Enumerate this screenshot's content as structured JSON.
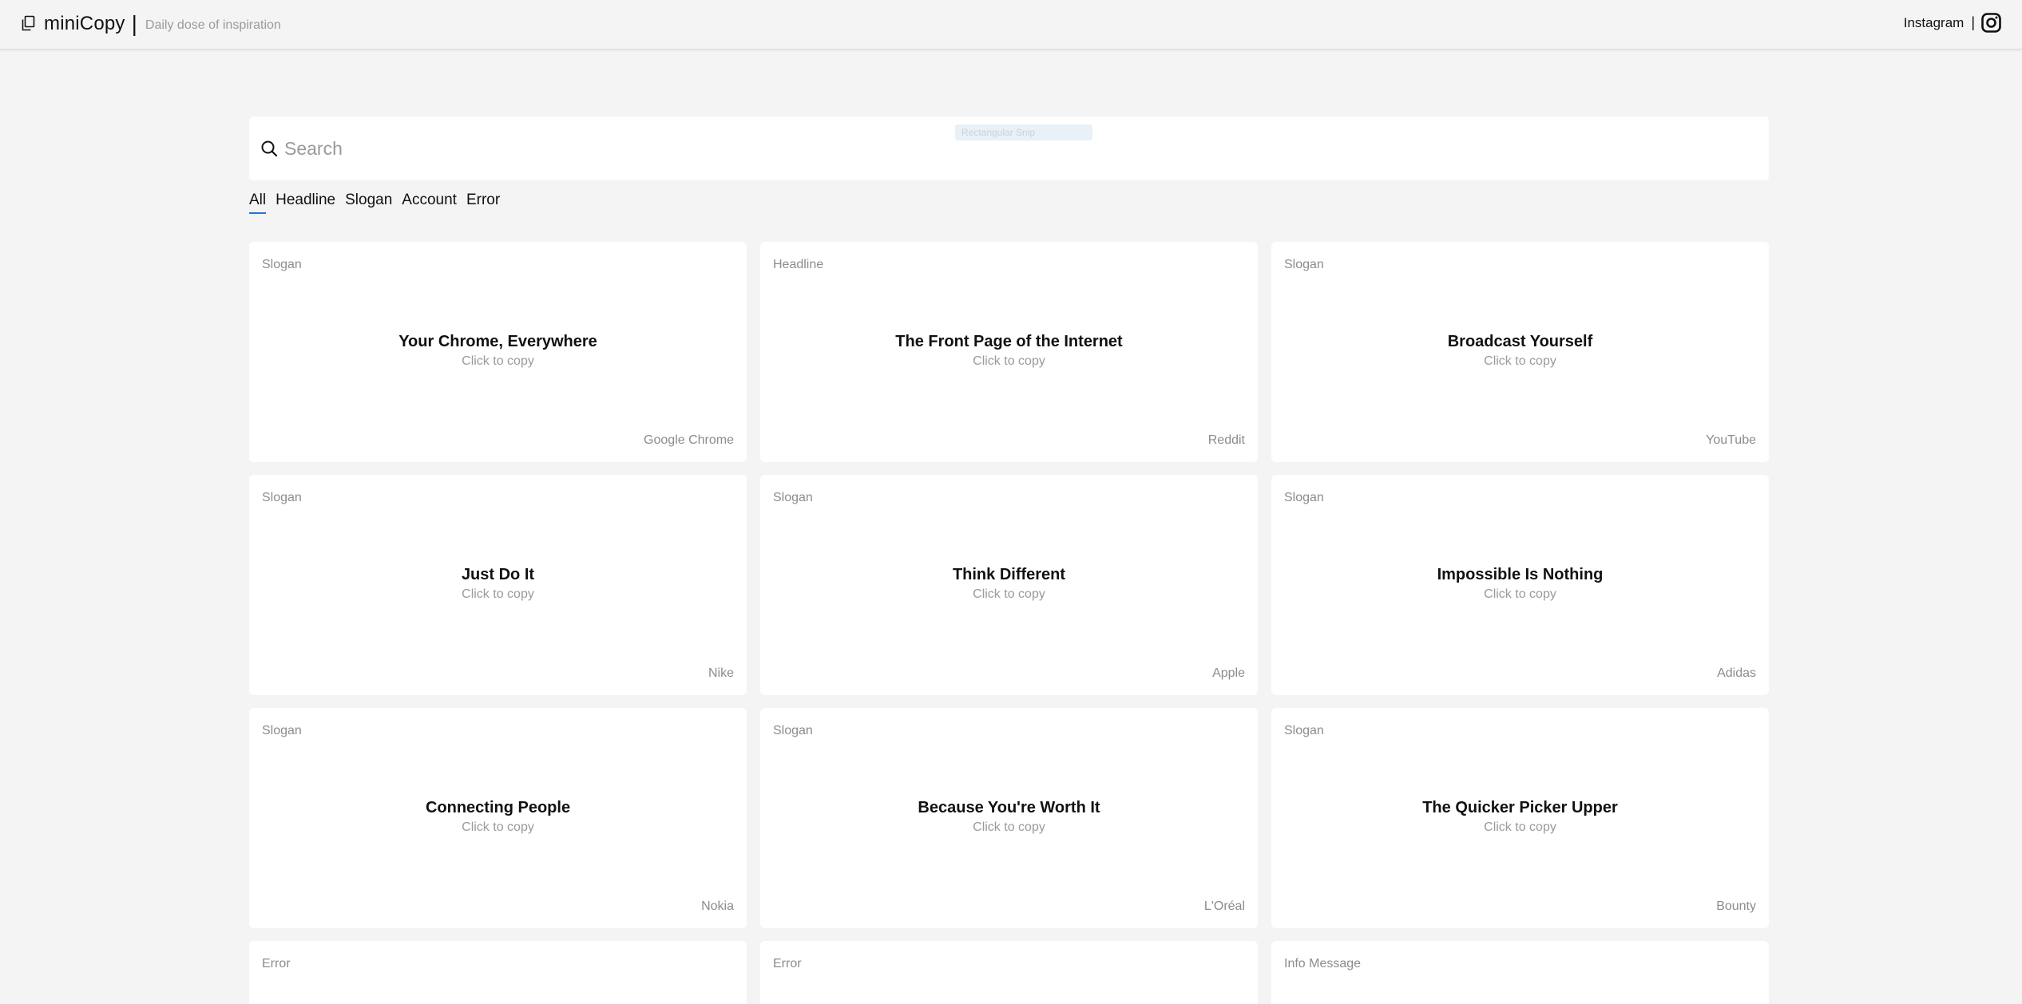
{
  "header": {
    "brand_name": "miniCopy",
    "separator": "|",
    "tagline": "Daily dose of inspiration",
    "instagram_label": "Instagram",
    "right_separator": "|"
  },
  "overlay": {
    "ghost_text": "Rectangular Snip"
  },
  "search": {
    "placeholder": "Search",
    "value": ""
  },
  "filters": {
    "active": "All",
    "tabs": [
      "All",
      "Headline",
      "Slogan",
      "Account",
      "Error"
    ]
  },
  "cards": [
    {
      "category": "Slogan",
      "title": "Your Chrome, Everywhere",
      "hint": "Click to copy",
      "source": "Google Chrome"
    },
    {
      "category": "Headline",
      "title": "The Front Page of the Internet",
      "hint": "Click to copy",
      "source": "Reddit"
    },
    {
      "category": "Slogan",
      "title": "Broadcast Yourself",
      "hint": "Click to copy",
      "source": "YouTube"
    },
    {
      "category": "Slogan",
      "title": "Just Do It",
      "hint": "Click to copy",
      "source": "Nike"
    },
    {
      "category": "Slogan",
      "title": "Think Different",
      "hint": "Click to copy",
      "source": "Apple"
    },
    {
      "category": "Slogan",
      "title": "Impossible Is Nothing",
      "hint": "Click to copy",
      "source": "Adidas"
    },
    {
      "category": "Slogan",
      "title": "Connecting People",
      "hint": "Click to copy",
      "source": "Nokia"
    },
    {
      "category": "Slogan",
      "title": "Because You're Worth It",
      "hint": "Click to copy",
      "source": "L'Oréal"
    },
    {
      "category": "Slogan",
      "title": "The Quicker Picker Upper",
      "hint": "Click to copy",
      "source": "Bounty"
    },
    {
      "category": "Error",
      "title": "",
      "hint": "",
      "source": ""
    },
    {
      "category": "Error",
      "title": "",
      "hint": "",
      "source": ""
    },
    {
      "category": "Info Message",
      "title": "",
      "hint": "",
      "source": ""
    }
  ],
  "colors": {
    "page_bg": "#f4f4f4",
    "card_bg": "#ffffff",
    "accent": "#2a73c9",
    "muted_text": "#8c8c8c"
  },
  "icons": {
    "brand": "copy-icon",
    "social": "instagram-icon",
    "search": "search-icon"
  }
}
